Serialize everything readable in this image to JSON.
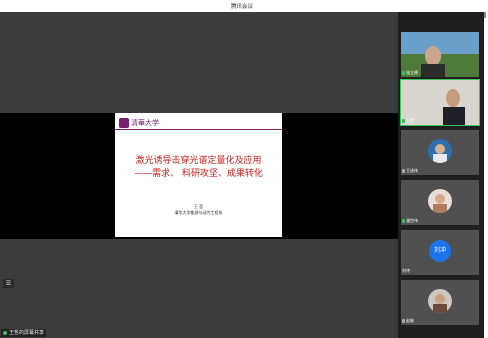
{
  "window": {
    "title": "腾讯会议"
  },
  "slide": {
    "logo_text": "清華大学",
    "title_line1": "激光诱导击穿光谱定量化及应用",
    "title_line2": "——需求、 科研攻坚、成果转化",
    "author": "王 哲",
    "affiliation": "清华大学能源与动力工程系"
  },
  "toolbar": {
    "notes_icon_glyph": "☰"
  },
  "share_status": {
    "label": "王哲的屏幕共享"
  },
  "participants": [
    {
      "name": "张立德",
      "mic": "on",
      "avatar": "photo"
    },
    {
      "name": "王哲",
      "mic": "on",
      "avatar": "photo",
      "active": true
    },
    {
      "name": "王成伟",
      "mic": "off",
      "avatar": "photo"
    },
    {
      "name": "潘世伟",
      "mic": "on",
      "avatar": "photo"
    },
    {
      "name": "刘冲",
      "mic": "off",
      "avatar": "initials",
      "initials": "刘冲"
    },
    {
      "name": "赵刚",
      "mic": "off",
      "avatar": "photo"
    }
  ],
  "colors": {
    "accent": "#3ec25c",
    "slide_title": "#c81e1e",
    "brand": "#7a1f6f",
    "initials_bg": "#1a73e8"
  }
}
